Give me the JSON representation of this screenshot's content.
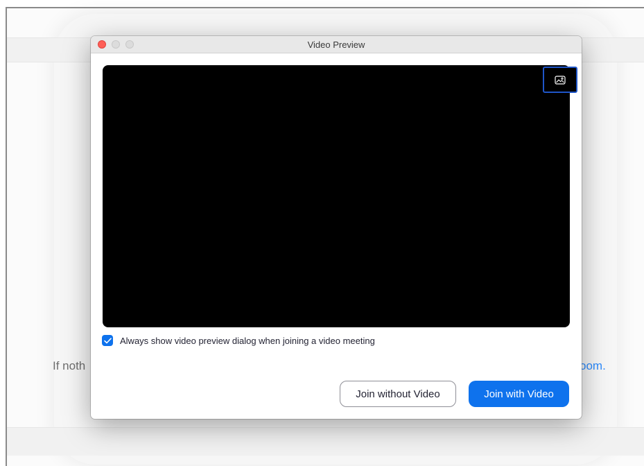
{
  "background_page": {
    "text_left": "If noth",
    "text_right": "oom.",
    "link_color": "#2d8cff"
  },
  "dialog": {
    "title": "Video Preview",
    "window_controls": [
      "close",
      "minimize",
      "maximize"
    ],
    "video": {
      "state": "black",
      "background_button_icon": "image-icon"
    },
    "checkbox": {
      "label": "Always show video preview dialog when joining a video meeting",
      "checked": true,
      "color": "#0e72ed"
    },
    "buttons": {
      "join_without_video": "Join without Video",
      "join_with_video": "Join with Video"
    },
    "accent_color": "#0e72ed"
  }
}
